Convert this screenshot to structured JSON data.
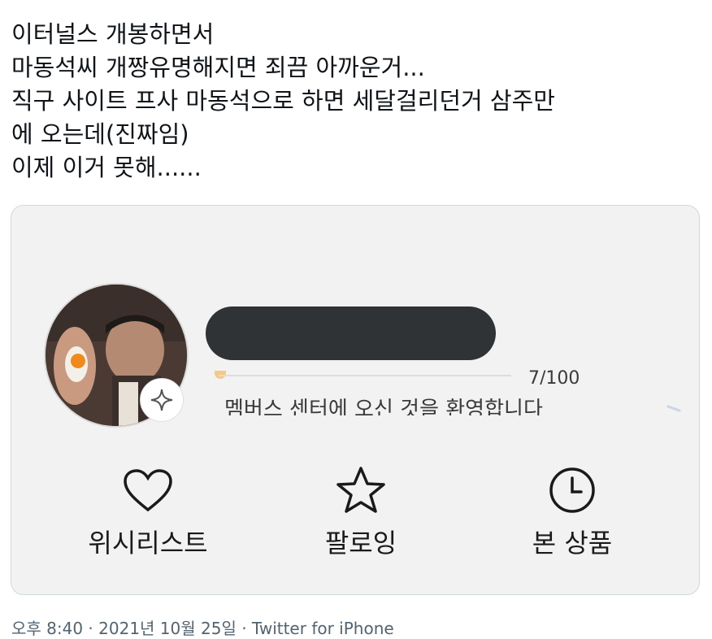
{
  "tweet": {
    "lines": [
      "이터널스 개봉하면서",
      "마동석씨 개짱유명해지면 죄끔 아까운거...",
      "직구 사이트 프사 마동석으로 하면 세달걸리던거 삼주만",
      "에 오는데(진짜임)",
      "이제 이거 못해......"
    ]
  },
  "profile_card": {
    "progress_count": "7/100",
    "welcome_text": "멤버스 센터에 오신 것을 환영합니다",
    "actions": [
      {
        "label": "위시리스트",
        "icon": "heart-icon"
      },
      {
        "label": "팔로잉",
        "icon": "star-icon"
      },
      {
        "label": "본 상품",
        "icon": "clock-icon"
      }
    ]
  },
  "meta": {
    "text": "오후 8:40 · 2021년 10월 25일 · Twitter for iPhone"
  }
}
